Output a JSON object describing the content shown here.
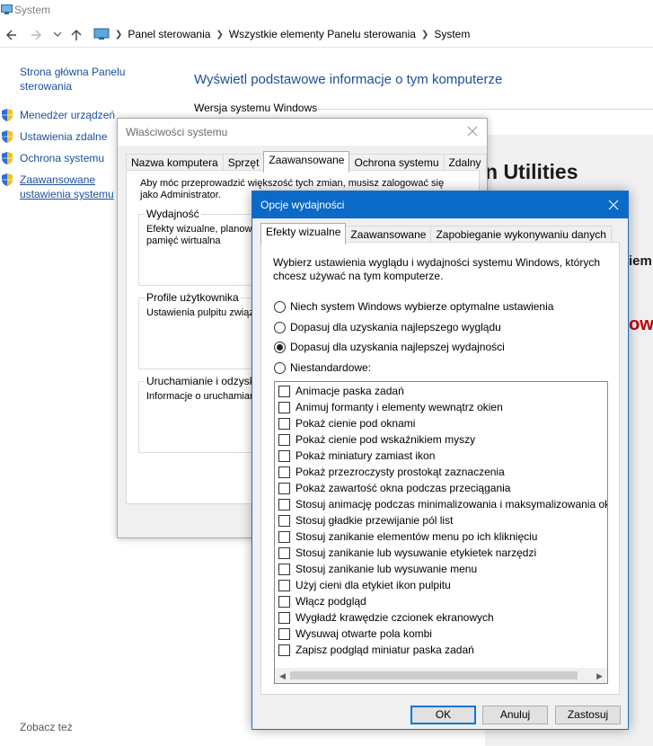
{
  "window": {
    "title": "System"
  },
  "address_bar": {
    "crumbs": [
      "Panel sterowania",
      "Wszystkie elementy Panelu sterowania",
      "System"
    ]
  },
  "left_nav": {
    "home_link": "Strona główna Panelu sterowania",
    "items": [
      {
        "label": "Menedżer urządzeń",
        "icon": "shield-icon"
      },
      {
        "label": "Ustawienia zdalne",
        "icon": "shield-icon"
      },
      {
        "label": "Ochrona systemu",
        "icon": "shield-icon"
      },
      {
        "label": "Zaawansowane ustawienia systemu",
        "icon": "shield-icon"
      }
    ],
    "see_also": "Zobacz też"
  },
  "main": {
    "heading": "Wyświetl podstawowe informacje o tym komputerze",
    "section_windows": "Wersja systemu Windows",
    "bg_fragments": [
      "n Utilities",
      "iem",
      "owa"
    ]
  },
  "system_properties": {
    "title": "Właściwości systemu",
    "tabs": [
      "Nazwa komputera",
      "Sprzęt",
      "Zaawansowane",
      "Ochrona systemu",
      "Zdalny"
    ],
    "active_tab": "Zaawansowane",
    "admin_note": "Aby móc przeprowadzić większość tych zmian, musisz zalogować się jako Administrator.",
    "groups": [
      {
        "caption": "Wydajność",
        "text": "Efekty wizualne, planowa"
      },
      {
        "caption": "Profile użytkownika",
        "text": "Ustawienia pulpitu związa"
      },
      {
        "caption": "Uruchamianie i odzyskiwa",
        "text": "Informacje o uruchamiani"
      }
    ],
    "group_extra": [
      "pamięć wirtualna"
    ]
  },
  "performance_options": {
    "title": "Opcje wydajności",
    "tabs": [
      "Efekty wizualne",
      "Zaawansowane",
      "Zapobieganie wykonywaniu danych"
    ],
    "active_tab": "Efekty wizualne",
    "description": "Wybierz ustawienia wyglądu i wydajności systemu Windows, których chcesz używać na tym komputerze.",
    "radios": [
      {
        "label": "Niech system Windows wybierze optymalne ustawienia",
        "selected": false
      },
      {
        "label": "Dopasuj dla uzyskania najlepszego wyglądu",
        "selected": false
      },
      {
        "label": "Dopasuj dla uzyskania najlepszej wydajności",
        "selected": true
      },
      {
        "label": "Niestandardowe:",
        "selected": false
      }
    ],
    "checkboxes": [
      "Animacje paska zadań",
      "Animuj formanty i elementy wewnątrz okien",
      "Pokaż cienie pod oknami",
      "Pokaż cienie pod wskaźnikiem myszy",
      "Pokaż miniatury zamiast ikon",
      "Pokaż przezroczysty prostokąt zaznaczenia",
      "Pokaż zawartość okna podczas przeciągania",
      "Stosuj animację podczas minimalizowania i maksymalizowania ok",
      "Stosuj gładkie przewijanie pól list",
      "Stosuj zanikanie elementów menu po ich kliknięciu",
      "Stosuj zanikanie lub wysuwanie etykietek narzędzi",
      "Stosuj zanikanie lub wysuwanie menu",
      "Użyj cieni dla etykiet ikon pulpitu",
      "Włącz podgląd",
      "Wygładź krawędzie czcionek ekranowych",
      "Wysuwaj otwarte pola kombi",
      "Zapisz podgląd miniatur paska zadań"
    ],
    "buttons": {
      "ok": "OK",
      "cancel": "Anuluj",
      "apply": "Zastosuj"
    }
  }
}
